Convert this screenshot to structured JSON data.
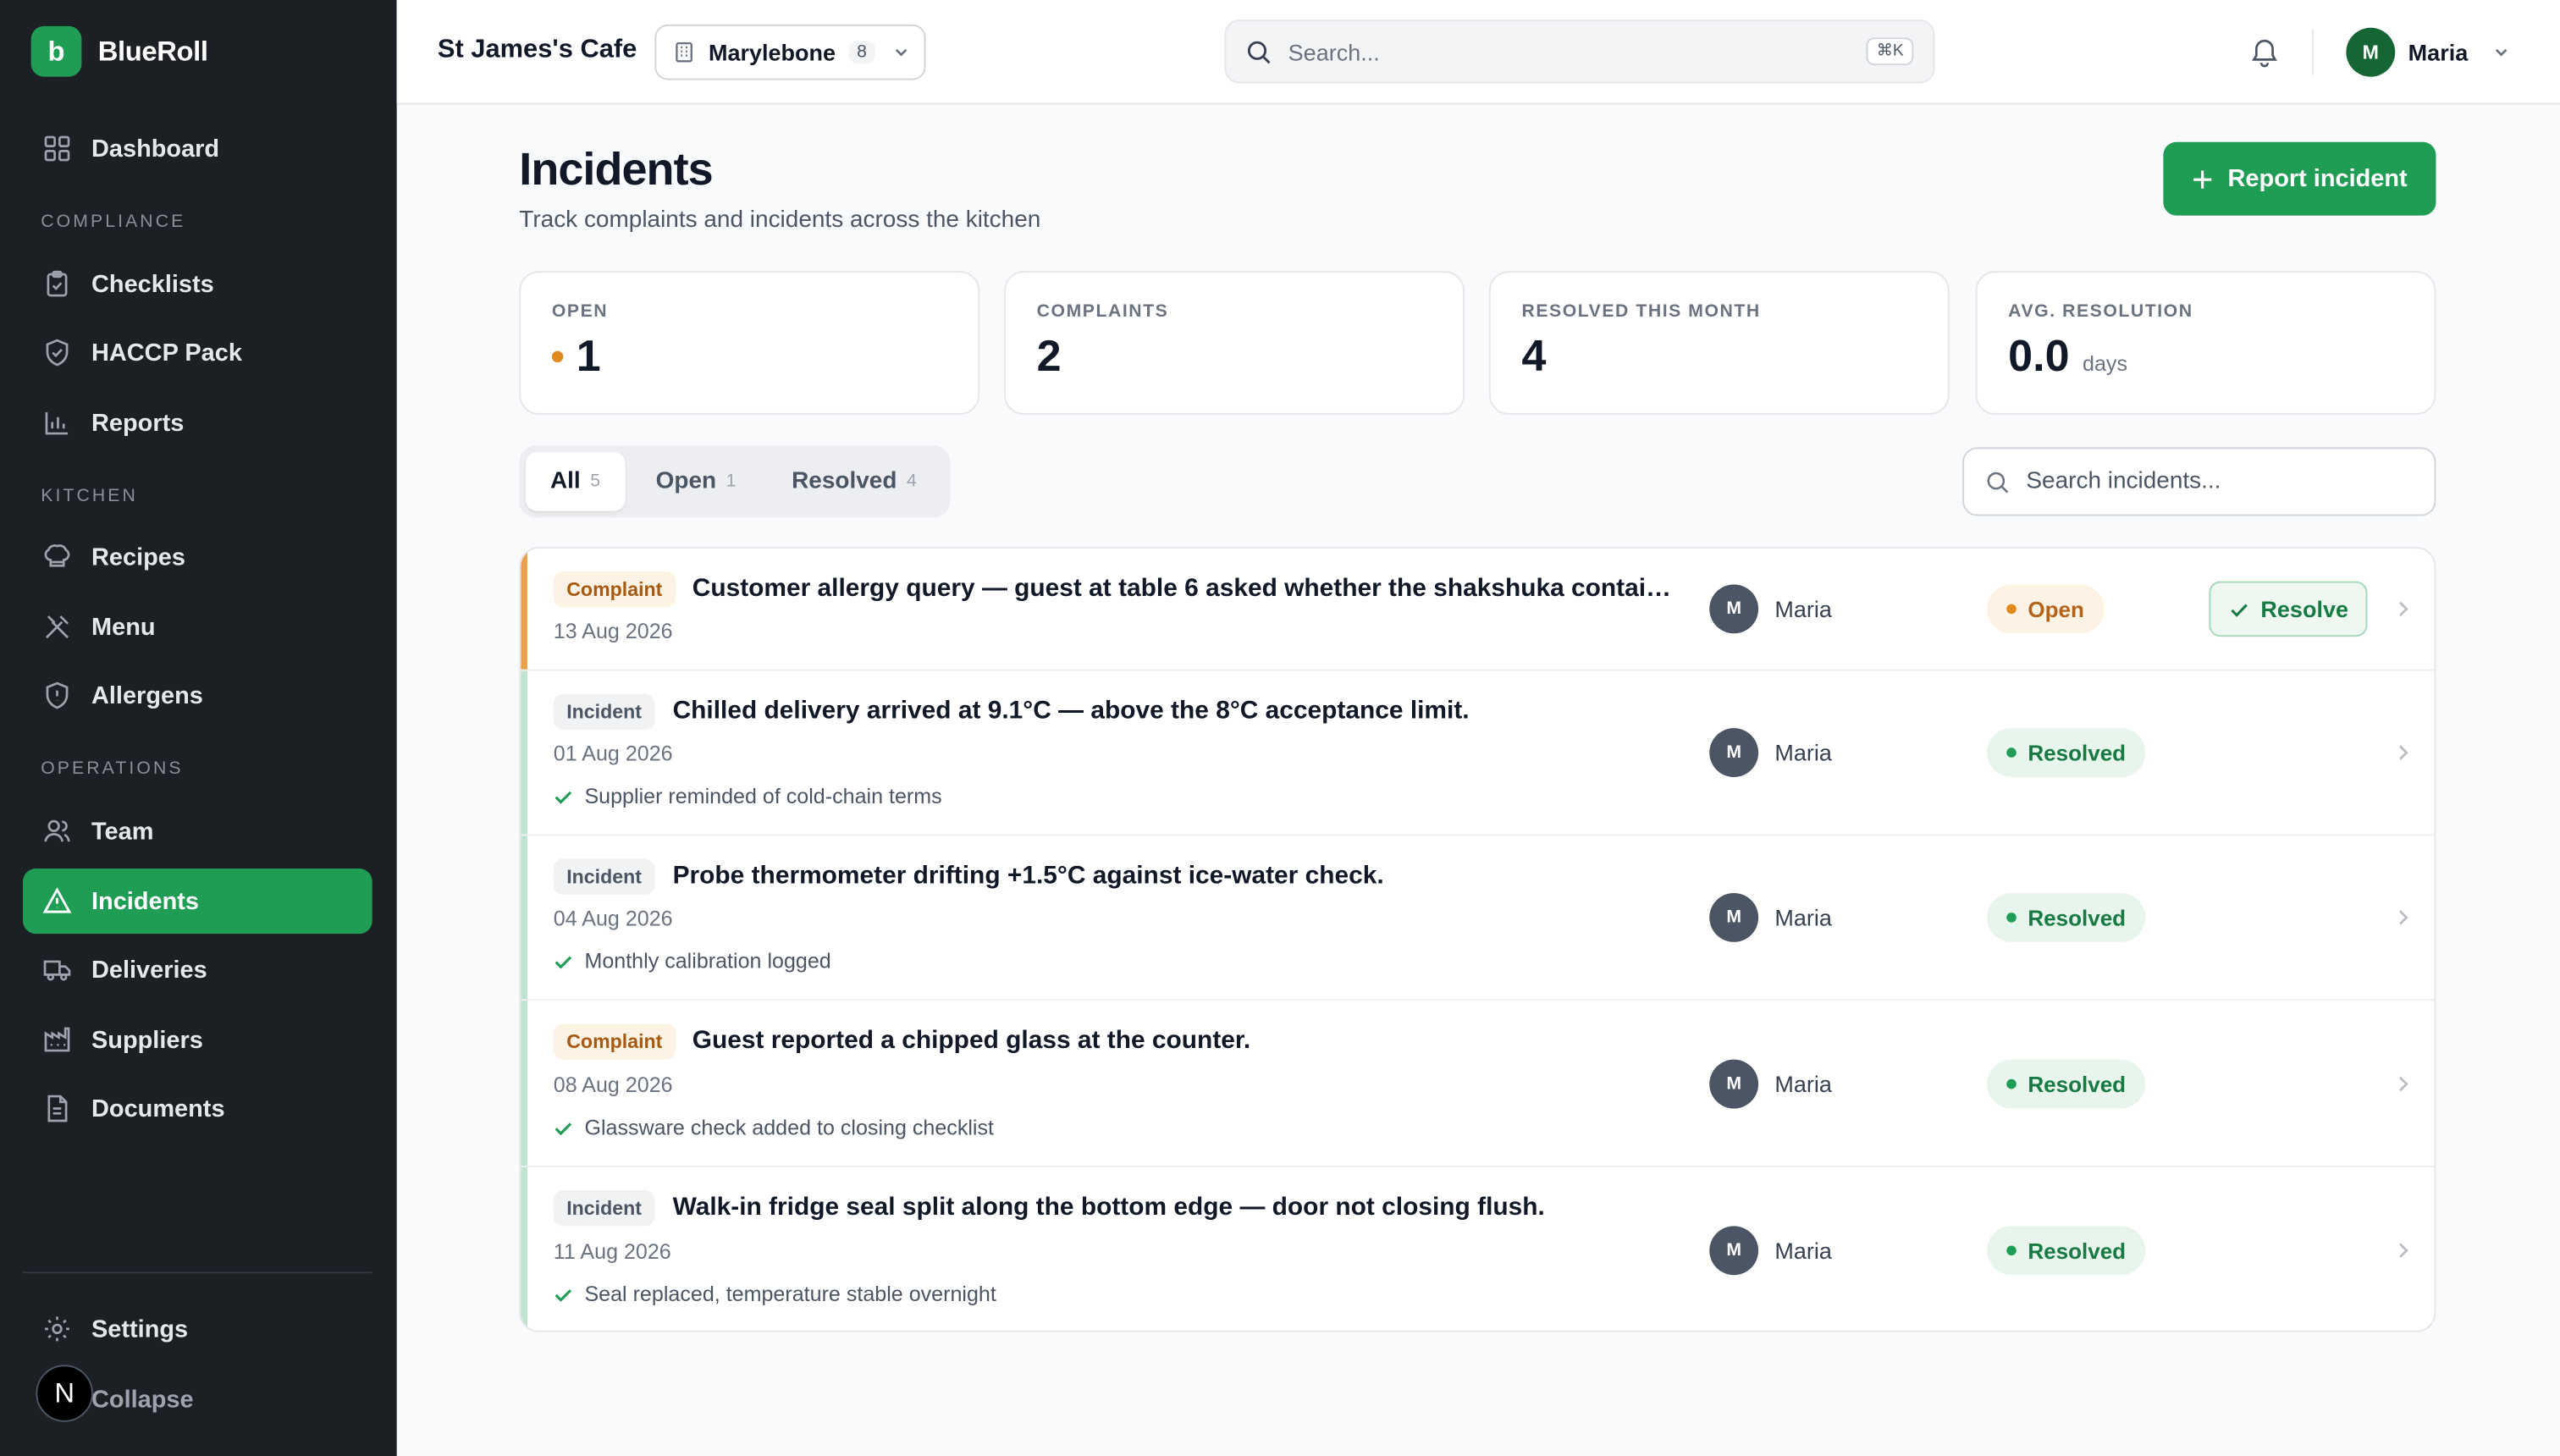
{
  "brand": {
    "logo_letter": "b",
    "name": "BlueRoll"
  },
  "sidebar": {
    "dashboard": "Dashboard",
    "sections": {
      "compliance": "COMPLIANCE",
      "kitchen": "KITCHEN",
      "operations": "OPERATIONS"
    },
    "items": [
      {
        "label": "Checklists",
        "icon": "clipboard-icon"
      },
      {
        "label": "HACCP Pack",
        "icon": "shield-check-icon"
      },
      {
        "label": "Reports",
        "icon": "bar-chart-icon"
      },
      {
        "label": "Recipes",
        "icon": "chef-hat-icon"
      },
      {
        "label": "Menu",
        "icon": "utensils-icon"
      },
      {
        "label": "Allergens",
        "icon": "shield-alert-icon"
      },
      {
        "label": "Team",
        "icon": "users-icon"
      },
      {
        "label": "Incidents",
        "icon": "warning-triangle-icon",
        "active": true
      },
      {
        "label": "Deliveries",
        "icon": "truck-icon"
      },
      {
        "label": "Suppliers",
        "icon": "factory-icon"
      },
      {
        "label": "Documents",
        "icon": "file-text-icon"
      }
    ],
    "settings": "Settings",
    "collapse": "Collapse",
    "n_badge": "N"
  },
  "topbar": {
    "site": "St James's Cafe",
    "location": {
      "name": "Marylebone",
      "count": "8"
    },
    "search_placeholder": "Search...",
    "search_shortcut": "⌘K",
    "user": {
      "initial": "M",
      "name": "Maria"
    }
  },
  "page": {
    "title": "Incidents",
    "subtitle": "Track complaints and incidents across the kitchen",
    "report_button": "Report incident"
  },
  "stats": [
    {
      "label": "OPEN",
      "value": "1"
    },
    {
      "label": "COMPLAINTS",
      "value": "2"
    },
    {
      "label": "RESOLVED THIS MONTH",
      "value": "4"
    },
    {
      "label": "AVG. RESOLUTION",
      "value": "0.0",
      "unit": "days"
    }
  ],
  "tabs": [
    {
      "label": "All",
      "count": "5"
    },
    {
      "label": "Open",
      "count": "1"
    },
    {
      "label": "Resolved",
      "count": "4"
    }
  ],
  "list_search_placeholder": "Search incidents...",
  "rows": [
    {
      "tag": "Complaint",
      "title": "Customer allergy query — guest at table 6 asked whether the shakshuka contains s...",
      "date": "13 Aug 2026",
      "assignee_initial": "M",
      "assignee": "Maria",
      "status": "Open",
      "action": "Resolve"
    },
    {
      "tag": "Incident",
      "title": "Chilled delivery arrived at 9.1°C — above the 8°C acceptance limit.",
      "date": "01 Aug 2026",
      "note": "Supplier reminded of cold-chain terms",
      "assignee_initial": "M",
      "assignee": "Maria",
      "status": "Resolved"
    },
    {
      "tag": "Incident",
      "title": "Probe thermometer drifting +1.5°C against ice-water check.",
      "date": "04 Aug 2026",
      "note": "Monthly calibration logged",
      "assignee_initial": "M",
      "assignee": "Maria",
      "status": "Resolved"
    },
    {
      "tag": "Complaint",
      "title": "Guest reported a chipped glass at the counter.",
      "date": "08 Aug 2026",
      "note": "Glassware check added to closing checklist",
      "assignee_initial": "M",
      "assignee": "Maria",
      "status": "Resolved"
    },
    {
      "tag": "Incident",
      "title": "Walk-in fridge seal split along the bottom edge — door not closing flush.",
      "date": "11 Aug 2026",
      "note": "Seal replaced, temperature stable overnight",
      "assignee_initial": "M",
      "assignee": "Maria",
      "status": "Resolved"
    }
  ],
  "colors": {
    "brand_green": "#1f9d55",
    "open_orange": "#e08a1e",
    "sidebar_bg": "#1c1f24"
  }
}
